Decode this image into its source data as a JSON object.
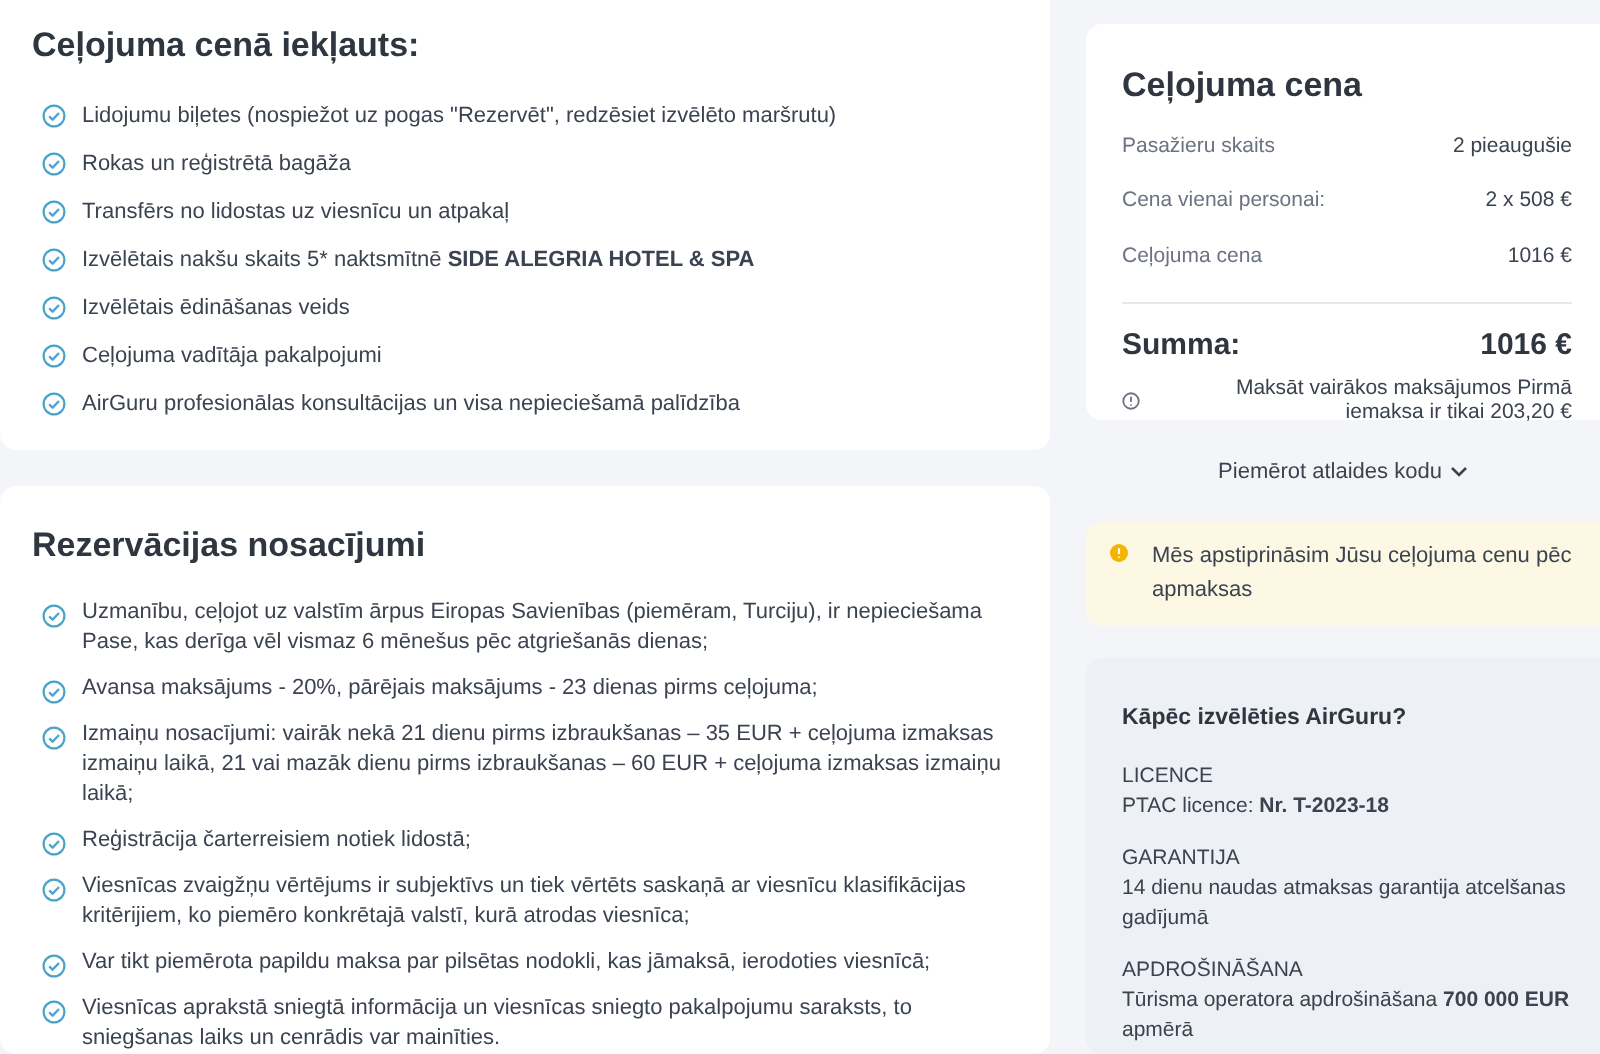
{
  "included": {
    "title": "Ceļojuma cenā iekļauts:",
    "items": [
      "Lidojumu biļetes (nospiežot uz pogas \"Rezervēt\", redzēsiet izvēlēto maršrutu)",
      "Rokas un reģistrētā bagāža",
      "Transfērs no lidostas uz viesnīcu un atpakaļ",
      "Izvēlētais nakšu skaits 5* naktsmītnē **SIDE ALEGRIA HOTEL & SPA**",
      "Izvēlētais ēdināšanas veids",
      "Ceļojuma vadītāja pakalpojumi",
      "AirGuru profesionālas konsultācijas un visa nepieciešamā palīdzība"
    ]
  },
  "conditions": {
    "title": "Rezervācijas nosacījumi",
    "items": [
      "Uzmanību, ceļojot uz valstīm ārpus Eiropas Savienības (piemēram, Turciju), ir nepieciešama Pase, kas derīga vēl vismaz 6 mēnešus pēc atgriešanās dienas;",
      "Avansa maksājums - 20%, pārējais maksājums - 23 dienas pirms ceļojuma;",
      "Izmaiņu nosacījumi: vairāk nekā 21 dienu pirms izbraukšanas – 35 EUR + ceļojuma izmaksas izmaiņu laikā, 21 vai mazāk dienu pirms izbraukšanas – 60 EUR + ceļojuma izmaksas izmaiņu laikā;",
      "Reģistrācija čarterreisiem notiek lidostā;",
      "Viesnīcas zvaigžņu vērtējums ir subjektīvs un tiek vērtēts saskaņā ar viesnīcu klasifikācijas kritērijiem, ko piemēro konkrētajā valstī, kurā atrodas viesnīca;",
      "Var tikt piemērota papildu maksa par pilsētas nodokli, kas jāmaksā, ierodoties viesnīcā;",
      "Viesnīcas aprakstā sniegtā informācija un viesnīcas sniegto pakalpojumu saraksts, to sniegšanas laiks un cenrādis var mainīties."
    ]
  },
  "price": {
    "title": "Ceļojuma cena",
    "rows": [
      {
        "label": "Pasažieru skaits",
        "value": "2 pieaugušie"
      },
      {
        "label": "Cena vienai personai:",
        "value": "2 x 508 €"
      },
      {
        "label": "Ceļojuma cena",
        "value": "1016 €"
      }
    ],
    "total_label": "Summa:",
    "total_value": "1016 €",
    "installments_note": "Maksāt vairākos maksājumos Pirmā iemaksa ir tikai 203,20 €"
  },
  "discount_link": "Piemērot atlaides kodu",
  "notice": "Mēs apstiprināsim Jūsu ceļojuma cenu pēc apmaksas",
  "why": {
    "title": "Kāpēc izvēlēties AirGuru?",
    "sections": [
      {
        "heading": "LICENCE",
        "text": "PTAC licence: **Nr. T-2023-18**"
      },
      {
        "heading": "GARANTIJA",
        "text": "14 dienu naudas atmaksas garantija atcelšanas gadījumā"
      },
      {
        "heading": "APDROŠINĀŠANA",
        "text": "Tūrisma operatora apdrošināšana **700 000 EUR** apmērā"
      }
    ]
  }
}
